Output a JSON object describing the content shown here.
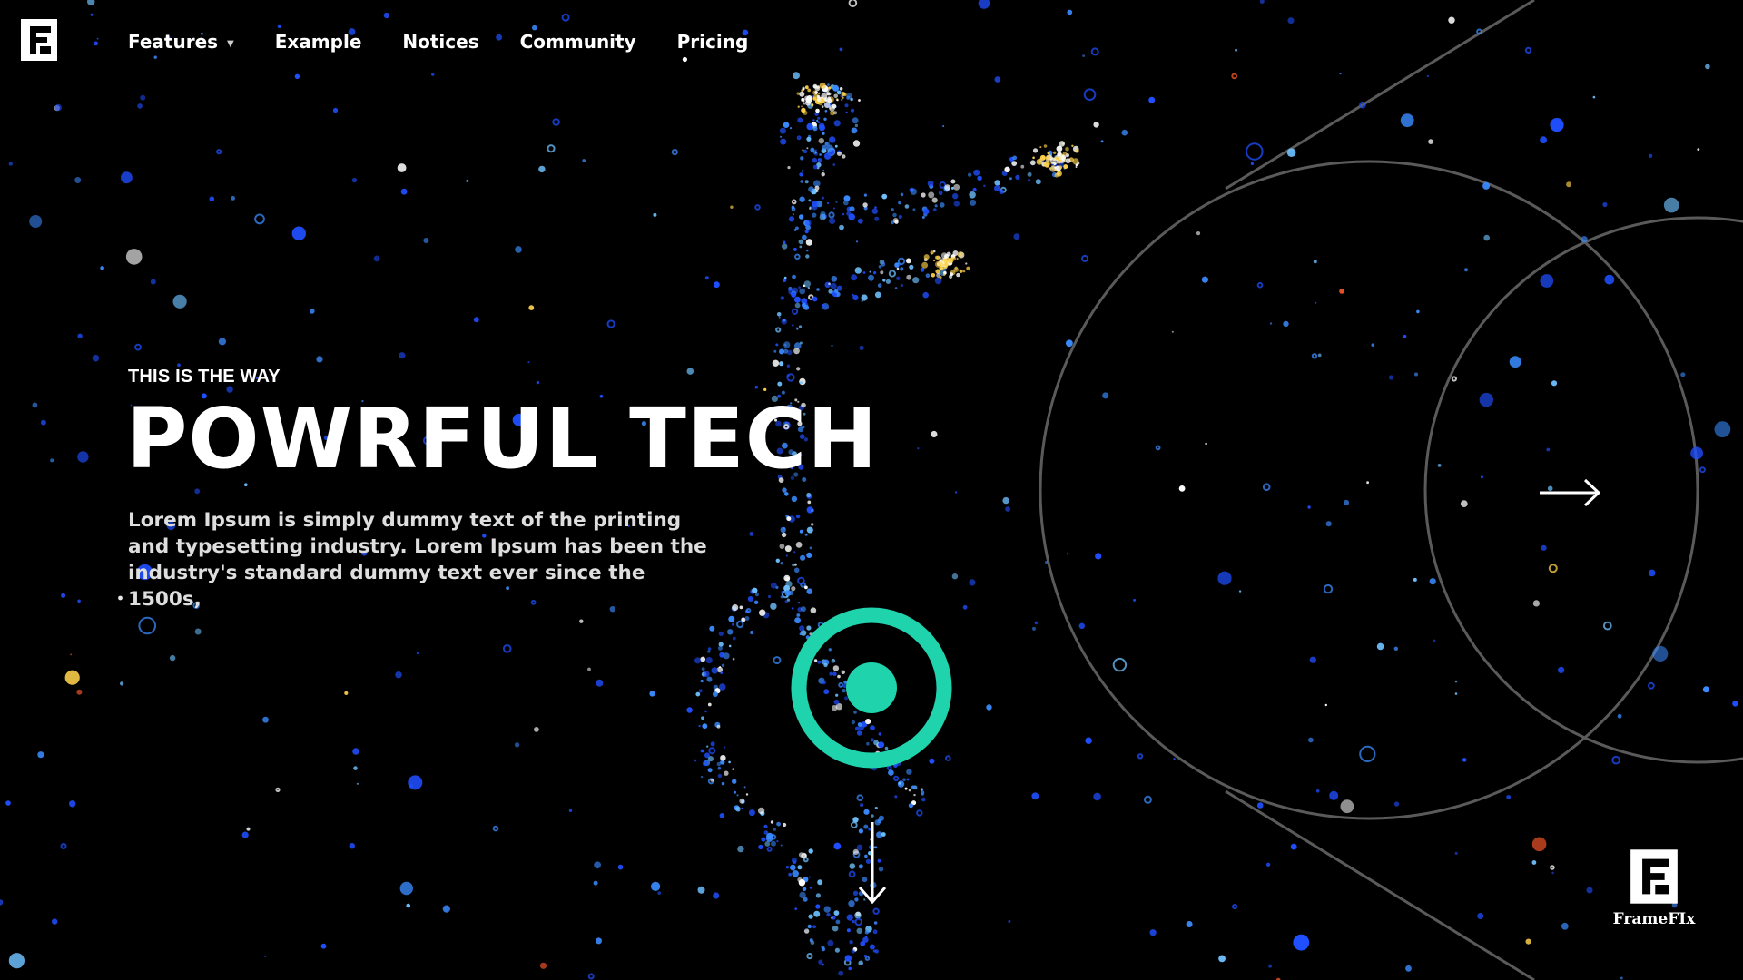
{
  "nav": {
    "items": [
      {
        "label": "Features",
        "has_dropdown": true
      },
      {
        "label": "Example"
      },
      {
        "label": "Notices"
      },
      {
        "label": "Community"
      },
      {
        "label": "Pricing"
      }
    ]
  },
  "hero": {
    "eyebrow": "THIS IS THE WAY",
    "title": "POWRFUL TECH",
    "description": "Lorem Ipsum is simply dummy text of the printing and typesetting industry. Lorem Ipsum has been the industry's standard dummy text ever since the 1500s,"
  },
  "brand": {
    "name": "FrameFIx"
  },
  "icons": {
    "logo": "frame-logo-icon",
    "dropdown": "chevron-down-icon",
    "target": "target-icon",
    "scroll": "arrow-down-icon",
    "next": "arrow-right-icon"
  },
  "colors": {
    "background": "#000000",
    "accent": "#1fd3ad",
    "text": "#ffffff",
    "orbit_lines": "#5a5a5a",
    "particles": [
      "#1f4fff",
      "#3a8bff",
      "#6ec1ff",
      "#ffffff",
      "#ffd24a",
      "#ff5a2a"
    ]
  }
}
